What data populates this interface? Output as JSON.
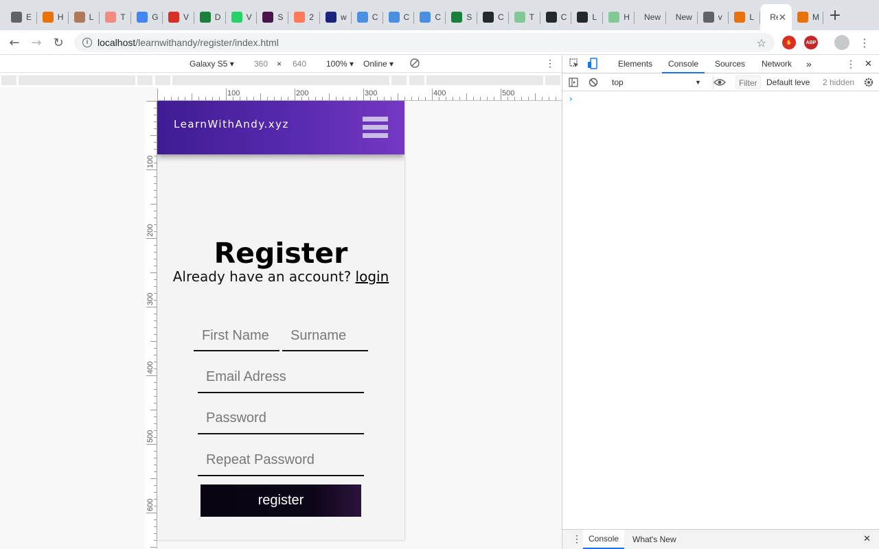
{
  "browser": {
    "tabs": [
      {
        "title": "E",
        "color": "#5f6368",
        "icon": "globe-icon"
      },
      {
        "title": "H",
        "color": "#e8710a",
        "icon": "xampp-icon"
      },
      {
        "title": "L",
        "color": "#b0785a",
        "icon": "site-icon"
      },
      {
        "title": "T",
        "color": "#f28b82",
        "icon": "text-icon"
      },
      {
        "title": "G",
        "color": "#4285f4",
        "icon": "google-icon"
      },
      {
        "title": "V",
        "color": "#d93025",
        "icon": "gmail-icon"
      },
      {
        "title": "D",
        "color": "#188038",
        "icon": "leaf-icon"
      },
      {
        "title": "V",
        "color": "#25d366",
        "icon": "whatsapp-icon"
      },
      {
        "title": "S",
        "color": "#4a154b",
        "icon": "slack-icon"
      },
      {
        "title": "2",
        "color": "#ff7a59",
        "icon": "hubspot-icon"
      },
      {
        "title": "w",
        "color": "#1a237e",
        "icon": "box-icon"
      },
      {
        "title": "C",
        "color": "#4a90e2",
        "icon": "heart-icon"
      },
      {
        "title": "C",
        "color": "#4a90e2",
        "icon": "heart-icon"
      },
      {
        "title": "C",
        "color": "#4a90e2",
        "icon": "heart-icon"
      },
      {
        "title": "S",
        "color": "#188038",
        "icon": "leaf-icon"
      },
      {
        "title": "C",
        "color": "#24292e",
        "icon": "github-icon"
      },
      {
        "title": "T",
        "color": "#81c995",
        "icon": "sheet-icon"
      },
      {
        "title": "C",
        "color": "#24292e",
        "icon": "github-icon"
      },
      {
        "title": "L",
        "color": "#24292e",
        "icon": "github-icon"
      },
      {
        "title": "H",
        "color": "#81c995",
        "icon": "sheet-icon"
      },
      {
        "title": "New",
        "color": "",
        "icon": ""
      },
      {
        "title": "New",
        "color": "",
        "icon": ""
      },
      {
        "title": "v",
        "color": "#5f6368",
        "icon": "globe-icon"
      },
      {
        "title": "L",
        "color": "#e8710a",
        "icon": "xampp-icon"
      },
      {
        "title": "Re",
        "color": "",
        "icon": ""
      },
      {
        "title": "M",
        "color": "#e8710a",
        "icon": "xampp-icon"
      }
    ],
    "new_tab": "+",
    "active_close": "✕",
    "url_host": "localhost",
    "url_path": "/learnwithandy/register/index.html",
    "ext_abp": "ABP"
  },
  "device_toolbar": {
    "device": "Galaxy S5 ▾",
    "width": "360",
    "times": "×",
    "height": "640",
    "zoom": "100% ▾",
    "throttle": "Online ▾"
  },
  "ruler": {
    "h_labels": [
      "100",
      "200",
      "300",
      "400",
      "500"
    ],
    "v_labels": [
      "100",
      "200",
      "300",
      "400",
      "500",
      "600"
    ]
  },
  "page": {
    "brand": "LearnWithAndy.xyz",
    "title": "Register",
    "subtitle": "Already have an account?",
    "login_link": "login",
    "first_name_placeholder": "First Name",
    "surname_placeholder": "Surname",
    "email_placeholder": "Email Adress",
    "password_placeholder": "Password",
    "repeat_password_placeholder": "Repeat Password",
    "register_button": "register"
  },
  "devtools": {
    "tabs": [
      "Elements",
      "Console",
      "Sources",
      "Network"
    ],
    "active_tab": "Console",
    "more": "»",
    "context": "top",
    "filter_placeholder": "Filter",
    "levels": "Default leve",
    "hidden": "2 hidden",
    "prompt": "›",
    "drawer_tabs": [
      "Console",
      "What's New"
    ]
  },
  "colors": {
    "nav_gradient_start": "#3f1c94",
    "nav_gradient_end": "#7638c4",
    "button_dark": "#0d0618",
    "devtools_accent": "#1a73e8"
  }
}
